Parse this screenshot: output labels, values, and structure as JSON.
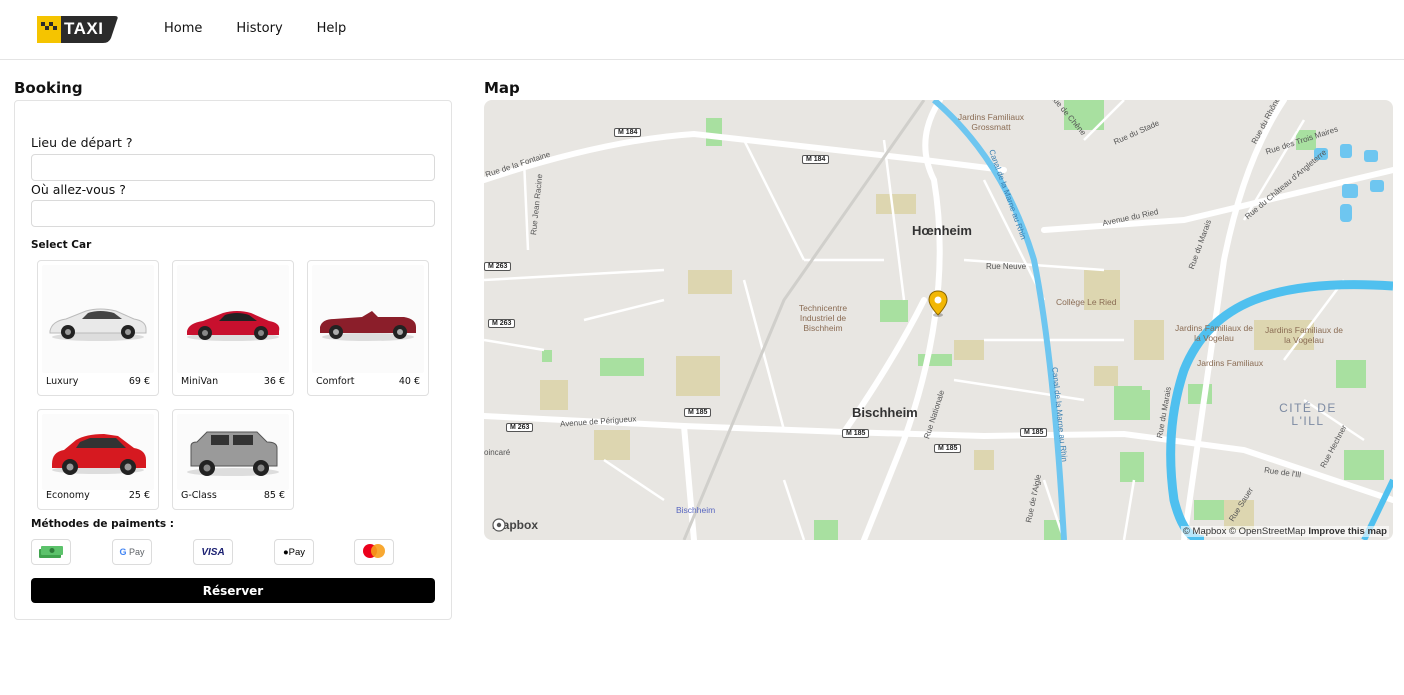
{
  "header": {
    "logo_text": "TAXI",
    "nav": [
      "Home",
      "History",
      "Help"
    ]
  },
  "booking": {
    "title": "Booking",
    "departure_label": "Lieu de départ ?",
    "departure_value": "",
    "destination_label": "Où allez-vous ?",
    "destination_value": "",
    "select_car_label": "Select Car",
    "cars": [
      {
        "name": "Luxury",
        "price": "69 €",
        "color": "#e6e6e6",
        "icon": "sports-car-icon"
      },
      {
        "name": "MiniVan",
        "price": "36 €",
        "color": "#c8102e",
        "icon": "sports-car-icon"
      },
      {
        "name": "Comfort",
        "price": "40 €",
        "color": "#8b1e2a",
        "icon": "convertible-car-icon"
      },
      {
        "name": "Economy",
        "price": "25 €",
        "color": "#d61920",
        "icon": "suv-icon"
      },
      {
        "name": "G-Class",
        "price": "85 €",
        "color": "#9a9a9a",
        "icon": "offroad-suv-icon"
      }
    ],
    "payment_label": "Méthodes de paiments :",
    "payment_methods": [
      {
        "name": "cash",
        "icon": "cash-icon"
      },
      {
        "name": "G Pay",
        "icon": "google-pay-icon"
      },
      {
        "name": "VISA",
        "icon": "visa-icon"
      },
      {
        "name": "Pay",
        "icon": "apple-pay-icon"
      },
      {
        "name": "mastercard",
        "icon": "mastercard-icon"
      }
    ],
    "reserve_label": "Réserver"
  },
  "map": {
    "title": "Map",
    "cities": [
      "Hœnheim",
      "Bischheim"
    ],
    "pois": [
      "Jardins Familiaux Grossmatt",
      "Technicentre Industriel de Bischheim",
      "Collège Le Ried",
      "Jardins Familiaux de la Vogelau",
      "Jardins Familiaux de la Vogelau",
      "Jardins Familiaux",
      "Bischheim"
    ],
    "streets": [
      "Rue Neuve",
      "Avenue de Périgueux",
      "Avenue du Ried",
      "Rue du Marais",
      "Rue Nationale",
      "Rue de l'Aigle",
      "Rue de l'Ill",
      "Rue du Stade",
      "Rue des Trois Maires",
      "Rue du Château d'Angleterre",
      "Rue Jean Racine",
      "Rue de la Fontaine",
      "Rue du Rhône",
      "Rue de Chêne",
      "Canal de la Marne au Rhin",
      "Canal de la Marne au Rhin",
      "Rue Hechner",
      "Rue Sauer",
      "oincaré",
      "Rue du Marais"
    ],
    "road_badges": [
      "M 184",
      "M 184",
      "M 263",
      "M 263",
      "M 263",
      "M 185",
      "M 185",
      "M 185",
      "M 185"
    ],
    "district": "CITÉ DE L'ILL",
    "mapbox_logo": "mapbox",
    "attribution_1": "© Mapbox © OpenStreetMap",
    "attribution_2": "Improve this map",
    "marker_color": "#f2b705"
  }
}
